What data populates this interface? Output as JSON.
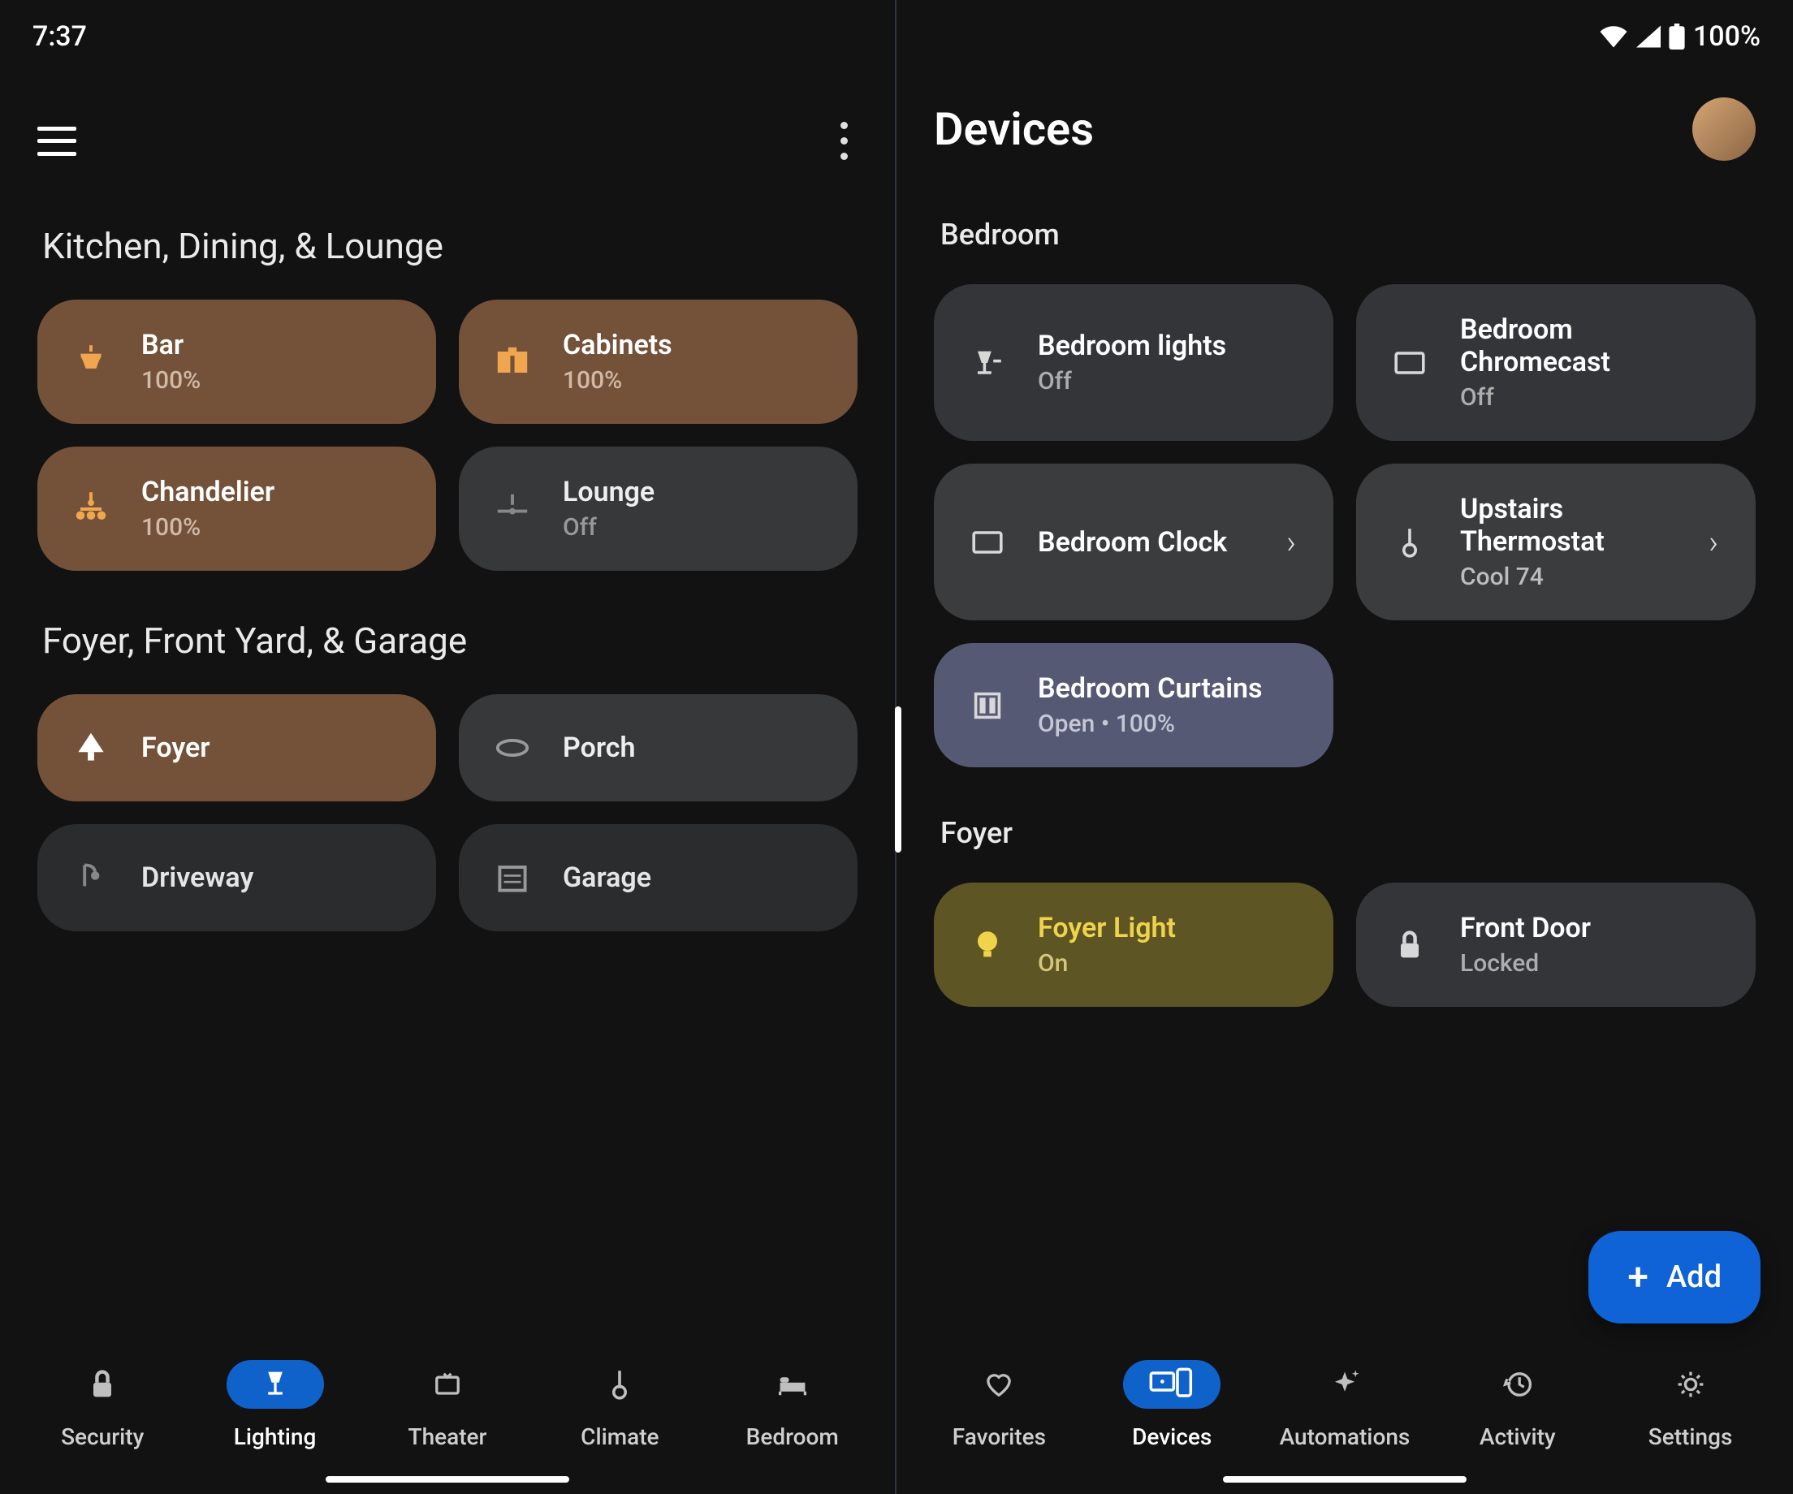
{
  "status": {
    "time": "7:37",
    "battery": "100%"
  },
  "left": {
    "sections": [
      {
        "label": "Kitchen, Dining, & Lounge",
        "tiles": [
          {
            "name": "Bar",
            "status": "100%",
            "style": "warm",
            "icon": "pendant-light"
          },
          {
            "name": "Cabinets",
            "status": "100%",
            "style": "warm",
            "icon": "cabinets"
          },
          {
            "name": "Chandelier",
            "status": "100%",
            "style": "warm",
            "icon": "chandelier"
          },
          {
            "name": "Lounge",
            "status": "Off",
            "style": "off",
            "icon": "fan"
          }
        ]
      },
      {
        "label": "Foyer, Front Yard, & Garage",
        "tiles": [
          {
            "name": "Foyer",
            "status": "",
            "style": "warm",
            "icon": "bulb-down"
          },
          {
            "name": "Porch",
            "status": "",
            "style": "off",
            "icon": "disc"
          },
          {
            "name": "Driveway",
            "status": "",
            "style": "off2",
            "icon": "lamp-post"
          },
          {
            "name": "Garage",
            "status": "",
            "style": "off2",
            "icon": "garage"
          }
        ]
      }
    ],
    "nav": [
      {
        "label": "Security",
        "icon": "lock",
        "active": false
      },
      {
        "label": "Lighting",
        "icon": "lamp",
        "active": true
      },
      {
        "label": "Theater",
        "icon": "tv",
        "active": false
      },
      {
        "label": "Climate",
        "icon": "thermo",
        "active": false
      },
      {
        "label": "Bedroom",
        "icon": "bed",
        "active": false
      }
    ]
  },
  "right": {
    "title": "Devices",
    "sections": [
      {
        "label": "Bedroom",
        "tiles": [
          {
            "name": "Bedroom lights",
            "status": "Off",
            "style": "dark",
            "icon": "lamp-table"
          },
          {
            "name": "Bedroom Chromecast",
            "status": "Off",
            "style": "dark",
            "icon": "tv-rect"
          },
          {
            "name": "Bedroom Clock",
            "status": "",
            "style": "gray",
            "icon": "tv-rect",
            "chev": true
          },
          {
            "name": "Upstairs Thermostat",
            "status": "Cool 74",
            "style": "gray",
            "icon": "thermo",
            "chev": true
          },
          {
            "name": "Bedroom Curtains",
            "status": "Open • 100%",
            "style": "lavender",
            "icon": "curtains"
          }
        ]
      },
      {
        "label": "Foyer",
        "tiles": [
          {
            "name": "Foyer Light",
            "status": "On",
            "style": "olive",
            "icon": "bulb"
          },
          {
            "name": "Front Door",
            "status": "Locked",
            "style": "dark",
            "icon": "lock"
          }
        ]
      }
    ],
    "fab": "Add",
    "nav": [
      {
        "label": "Favorites",
        "icon": "heart",
        "active": false
      },
      {
        "label": "Devices",
        "icon": "devices",
        "active": true
      },
      {
        "label": "Automations",
        "icon": "sparkle",
        "active": false
      },
      {
        "label": "Activity",
        "icon": "history",
        "active": false
      },
      {
        "label": "Settings",
        "icon": "gear",
        "active": false
      }
    ]
  }
}
